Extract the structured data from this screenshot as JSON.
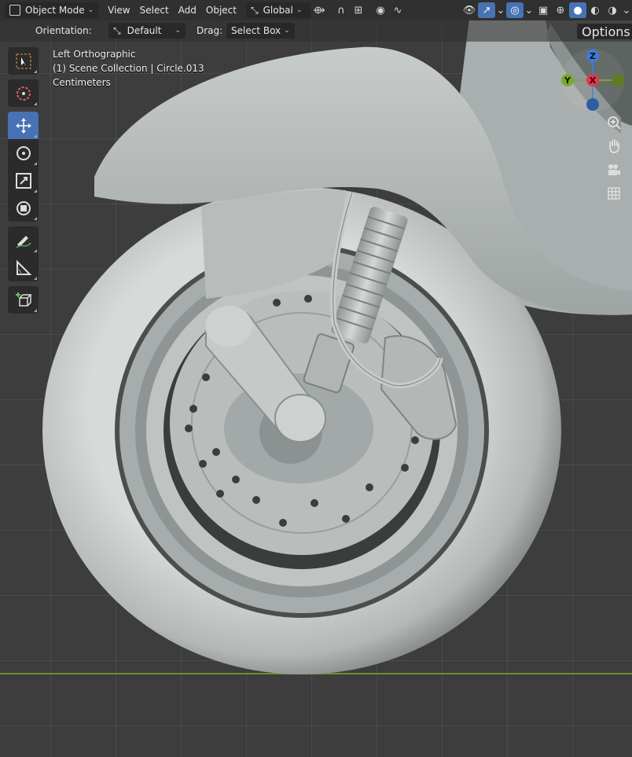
{
  "header": {
    "mode": "Object Mode",
    "menus": [
      "View",
      "Select",
      "Add",
      "Object"
    ],
    "transform_orientation": "Global"
  },
  "tool_settings": {
    "orientation_label": "Orientation:",
    "orientation_value": "Default",
    "drag_label": "Drag:",
    "drag_value": "Select Box",
    "options_label": "Options"
  },
  "viewport_info": {
    "view": "Left Orthographic",
    "collection": "(1) Scene Collection | Circle.013",
    "units": "Centimeters"
  },
  "gizmo": {
    "z_label": "Z",
    "y_label": "Y",
    "x_label": "X",
    "colors": {
      "x": "#e8344f",
      "y": "#7aaa27",
      "z": "#3a7ddb"
    }
  },
  "colors": {
    "accent": "#4772b3",
    "header_bg": "#303030",
    "viewport_bg": "#3d3d3d",
    "ground_axis": "#6c8f2c"
  },
  "toolbar_tools": [
    "select-box",
    "cursor",
    "move",
    "rotate",
    "scale",
    "transform",
    "annotate",
    "measure",
    "add-cube"
  ],
  "nav_icons": [
    "zoom-icon",
    "hand-pan-icon",
    "camera-icon",
    "grid-icon"
  ]
}
